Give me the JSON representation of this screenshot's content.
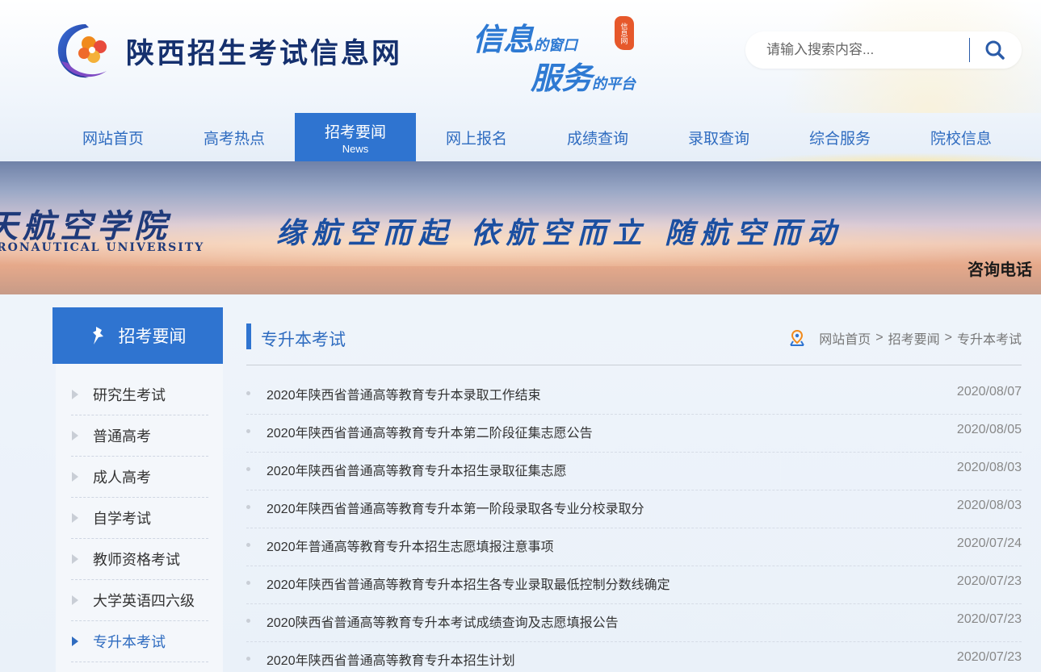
{
  "header": {
    "site_title": "陕西招生考试信息网",
    "slogan": {
      "line1_big": "信息",
      "line1_small": "的窗口",
      "line2_big": "服务",
      "line2_small": "的平台",
      "seal_text": "信息网"
    },
    "search": {
      "placeholder": "请输入搜索内容..."
    }
  },
  "nav": {
    "items": [
      {
        "label": "网站首页"
      },
      {
        "label": "高考热点"
      },
      {
        "label": "招考要闻",
        "sub": "News",
        "active": true
      },
      {
        "label": "网上报名"
      },
      {
        "label": "成绩查询"
      },
      {
        "label": "录取查询"
      },
      {
        "label": "综合服务"
      },
      {
        "label": "院校信息"
      }
    ]
  },
  "banner": {
    "school_cn": "天航空学院",
    "school_en": "RONAUTICAL UNIVERSITY",
    "motto": "缘航空而起 依航空而立 随航空而动",
    "hotline": "咨询电话"
  },
  "sidebar": {
    "title": "招考要闻",
    "items": [
      {
        "label": "研究生考试"
      },
      {
        "label": "普通高考"
      },
      {
        "label": "成人高考"
      },
      {
        "label": "自学考试"
      },
      {
        "label": "教师资格考试"
      },
      {
        "label": "大学英语四六级"
      },
      {
        "label": "专升本考试",
        "active": true
      }
    ]
  },
  "main": {
    "title": "专升本考试",
    "breadcrumb": [
      "网站首页",
      "招考要闻",
      "专升本考试"
    ],
    "breadcrumb_sep": ">",
    "news": [
      {
        "title": "2020年陕西省普通高等教育专升本录取工作结束",
        "date": "2020/08/07"
      },
      {
        "title": "2020年陕西省普通高等教育专升本第二阶段征集志愿公告",
        "date": "2020/08/05"
      },
      {
        "title": "2020年陕西省普通高等教育专升本招生录取征集志愿",
        "date": "2020/08/03"
      },
      {
        "title": "2020年陕西省普通高等教育专升本第一阶段录取各专业分校录取分",
        "date": "2020/08/03"
      },
      {
        "title": "2020年普通高等教育专升本招生志愿填报注意事项",
        "date": "2020/07/24"
      },
      {
        "title": "2020年陕西省普通高等教育专升本招生各专业录取最低控制分数线确定",
        "date": "2020/07/23"
      },
      {
        "title": "2020陕西省普通高等教育专升本考试成绩查询及志愿填报公告",
        "date": "2020/07/23"
      },
      {
        "title": "2020年陕西省普通高等教育专升本招生计划",
        "date": "2020/07/23"
      }
    ]
  },
  "colors": {
    "primary": "#2f74d0",
    "title_dark": "#15306e",
    "accent_orange": "#e6582b"
  }
}
